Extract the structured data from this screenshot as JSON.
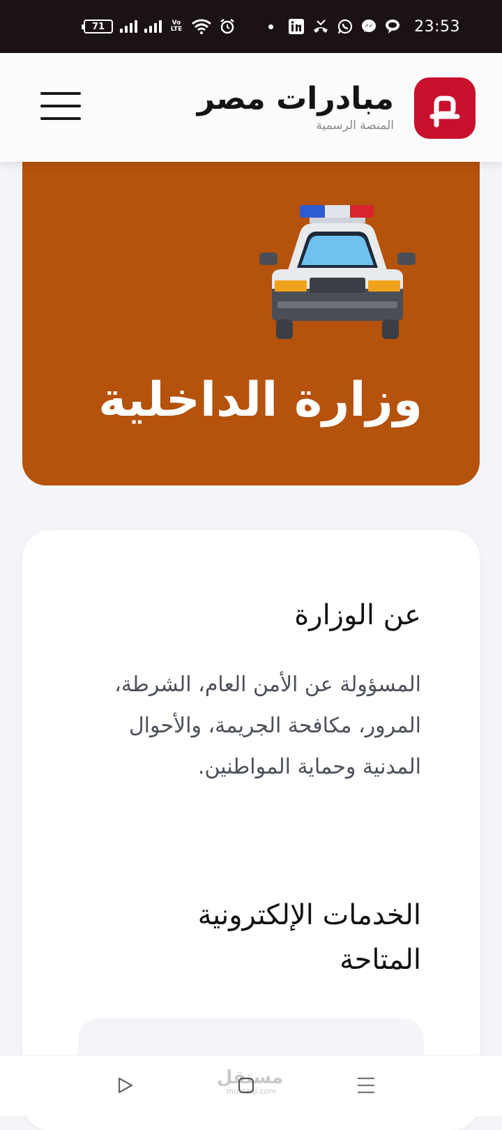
{
  "status_bar": {
    "battery": "71",
    "network_label": "Vo LTE",
    "time": "23:53",
    "icons": [
      "battery-icon",
      "signal-icon",
      "signal-icon",
      "volte-icon",
      "wifi-icon",
      "alarm-icon",
      "notification-dot",
      "linkedin-icon",
      "missed-call-icon",
      "whatsapp-icon",
      "messenger-icon",
      "chat-icon"
    ]
  },
  "header": {
    "title": "مبادرات مصر",
    "subtitle": "المنصة الرسمية",
    "logo_letter": "م",
    "accent": "#c8102e",
    "menu_icon": "hamburger-icon"
  },
  "hero": {
    "title": "وزارة الداخلية",
    "background": "#b5520c",
    "icon": "police-car-icon"
  },
  "about": {
    "title": "عن الوزارة",
    "body": "المسؤولة عن الأمن العام، الشرطة، المرور، مكافحة الجريمة، والأحوال المدنية وحماية المواطنين."
  },
  "services": {
    "title": "الخدمات الإلكترونية المتاحة"
  },
  "watermark": {
    "text": "مستقل",
    "sub": "mostaql.com"
  },
  "nav": {
    "icons": [
      "back-icon",
      "home-icon",
      "recent-apps-icon"
    ]
  }
}
